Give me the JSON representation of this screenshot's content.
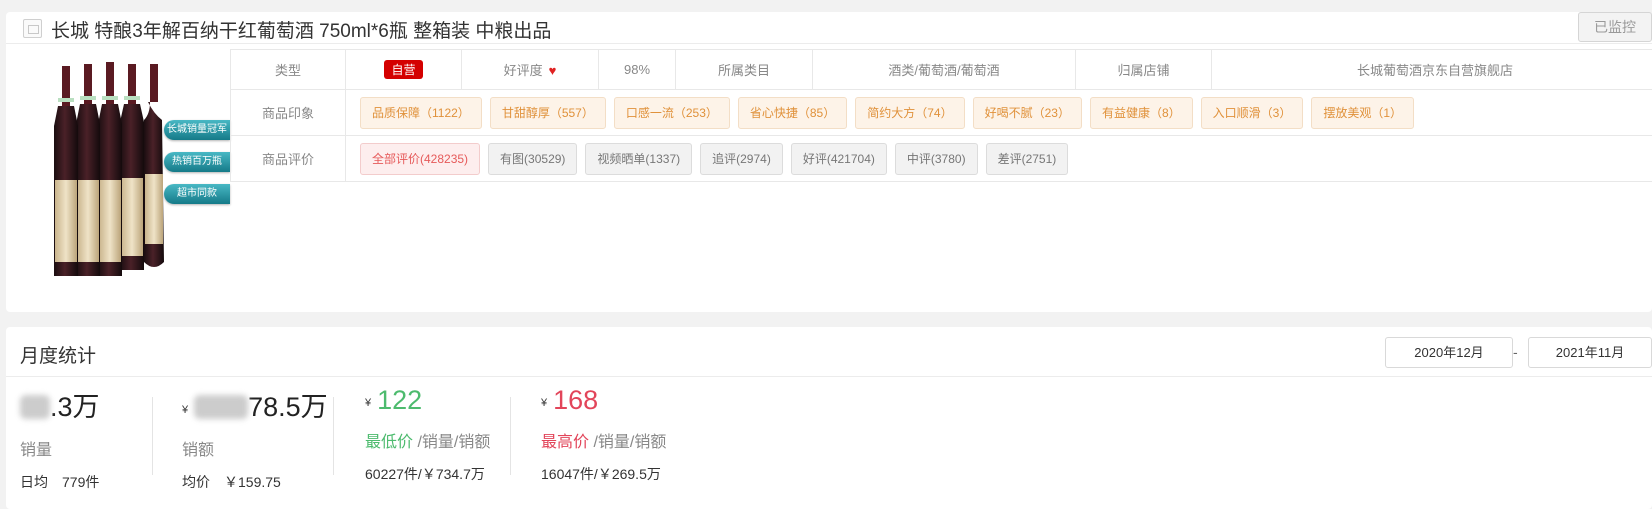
{
  "product": {
    "title": "长城 特酿3年解百纳干红葡萄酒 750ml*6瓶 整箱装 中粮出品",
    "monitor_button": "已监控",
    "image_icon": "image-placeholder-icon",
    "badges": [
      "长城销量冠军",
      "热销百万瓶",
      "超市同款"
    ]
  },
  "attributes": {
    "type_label": "类型",
    "type_value": "自营",
    "rating_label": "好评度",
    "rating_icon": "heart-icon",
    "rating_value": "98%",
    "category_label": "所属类目",
    "category_value": "酒类/葡萄酒/葡萄酒",
    "store_label": "归属店铺",
    "store_value": "长城葡萄酒京东自营旗舰店",
    "impression_label": "商品印象",
    "impressions": [
      "品质保障（1122）",
      "甘甜醇厚（557）",
      "口感一流（253）",
      "省心快捷（85）",
      "简约大方（74）",
      "好喝不腻（23）",
      "有益健康（8）",
      "入口顺滑（3）",
      "摆放美观（1）"
    ],
    "review_label": "商品评价",
    "reviews": [
      "全部评价(428235)",
      "有图(30529)",
      "视频晒单(1337)",
      "追评(2974)",
      "好评(421704)",
      "中评(3780)",
      "差评(2751)"
    ]
  },
  "monthly": {
    "title": "月度统计",
    "date_from": "2020年12月",
    "date_sep": "-",
    "date_to": "2021年11月",
    "sales": {
      "value_visible": ".3万",
      "label": "销量",
      "daily_label": "日均",
      "daily_value": "779件"
    },
    "revenue": {
      "currency": "¥",
      "value_visible": "78.5万",
      "label": "销额",
      "avg_label": "均价",
      "avg_value": "￥159.75"
    },
    "lowest": {
      "currency": "¥",
      "price": "122",
      "label": "最低价",
      "suffix": " /销量/销额",
      "detail": "60227件/￥734.7万"
    },
    "highest": {
      "currency": "¥",
      "price": "168",
      "label": "最高价",
      "suffix": " /销量/销额",
      "detail": "16047件/￥269.5万"
    }
  },
  "colors": {
    "self_tag": "#d40000",
    "lowest": "#4dbb6e",
    "highest": "#e2455a",
    "impression_text": "#e0913a"
  }
}
